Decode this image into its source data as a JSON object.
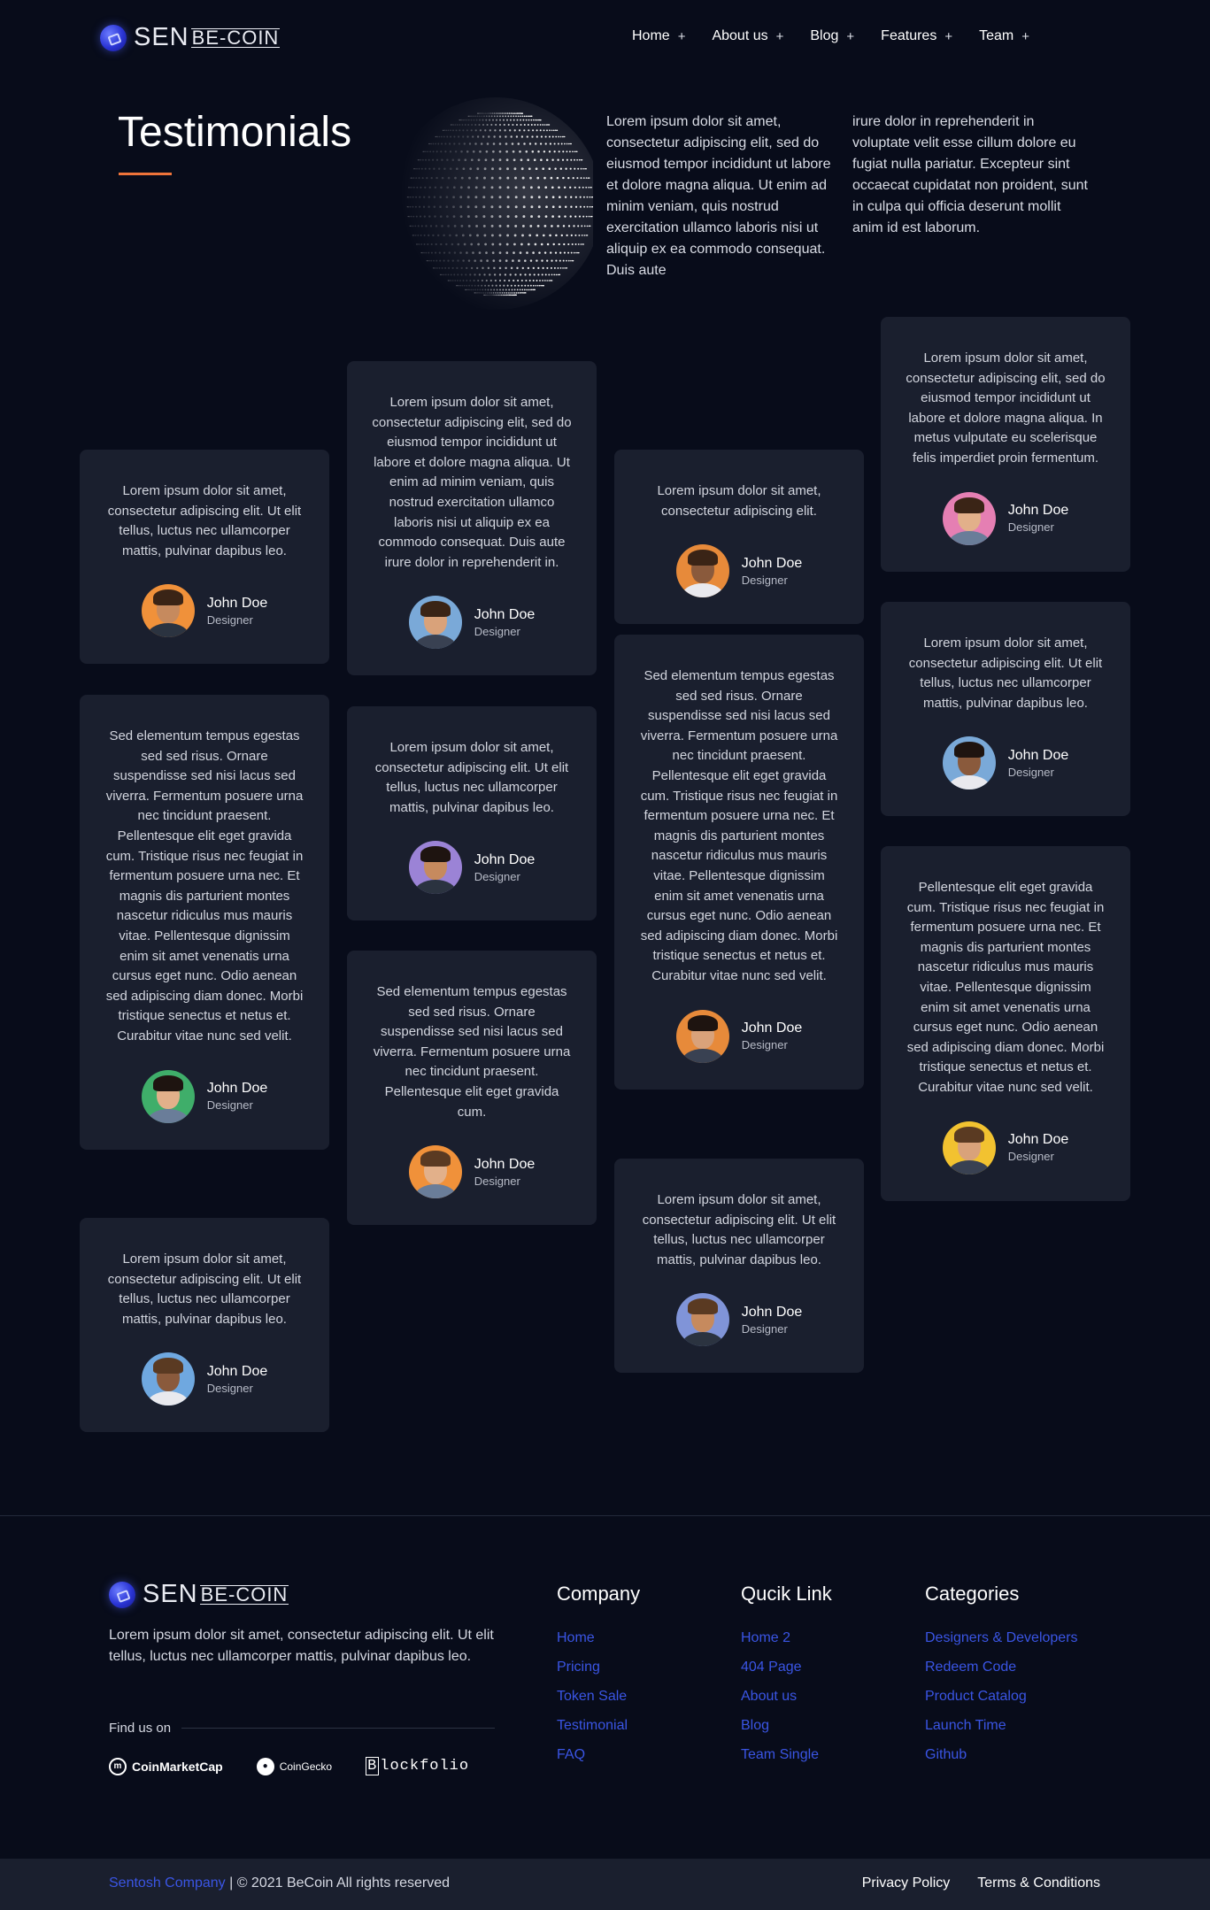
{
  "brand": {
    "sen": "SEN",
    "becoin": "BE-COIN"
  },
  "nav": [
    {
      "label": "Home",
      "suffix": "+"
    },
    {
      "label": "About us",
      "suffix": "+"
    },
    {
      "label": "Blog",
      "suffix": "+"
    },
    {
      "label": "Features",
      "suffix": "+"
    },
    {
      "label": "Team",
      "suffix": "+"
    }
  ],
  "hero": {
    "title": "Testimonials",
    "text_col1": "Lorem ipsum dolor sit amet, consectetur adipiscing elit, sed do eiusmod tempor incididunt ut labore et dolore magna aliqua. Ut enim ad minim veniam, quis nostrud exercitation ullamco laboris nisi ut aliquip ex ea commodo consequat. Duis aute",
    "text_col2": "irure dolor in reprehenderit in voluptate velit esse cillum dolore eu fugiat nulla pariatur. Excepteur sint occaecat cupidatat non proident, sunt in culpa qui officia deserunt mollit anim id est laborum."
  },
  "testimonials": [
    {
      "text": "Lorem ipsum dolor sit amet, consectetur adipiscing elit. Ut elit tellus, luctus nec ullamcorper mattis, pulvinar dapibus leo.",
      "name": "John Doe",
      "role": "Designer",
      "avatar_bg": "#f0913a"
    },
    {
      "text": "Sed elementum tempus egestas sed sed risus. Ornare suspendisse sed nisi lacus sed viverra. Fermentum posuere urna nec tincidunt praesent. Pellentesque elit eget gravida cum. Tristique risus nec feugiat in fermentum posuere urna nec. Et magnis dis parturient montes nascetur ridiculus mus mauris vitae. Pellentesque dignissim enim sit amet venenatis urna cursus eget nunc. Odio aenean sed adipiscing diam donec. Morbi tristique senectus et netus et. Curabitur vitae nunc sed velit.",
      "name": "John Doe",
      "role": "Designer",
      "avatar_bg": "#3fae6a"
    },
    {
      "text": "Lorem ipsum dolor sit amet, consectetur adipiscing elit. Ut elit tellus, luctus nec ullamcorper mattis, pulvinar dapibus leo.",
      "name": "John Doe",
      "role": "Designer",
      "avatar_bg": "#6fa8e0"
    },
    {
      "text": "Lorem ipsum dolor sit amet, consectetur adipiscing elit, sed do eiusmod tempor incididunt ut labore et dolore magna aliqua. Ut enim ad minim veniam, quis nostrud exercitation ullamco laboris nisi ut aliquip ex ea commodo consequat. Duis aute irure dolor in reprehenderit in.",
      "name": "John Doe",
      "role": "Designer",
      "avatar_bg": "#7aa9d8"
    },
    {
      "text": "Lorem ipsum dolor sit amet, consectetur adipiscing elit. Ut elit tellus, luctus nec ullamcorper mattis, pulvinar dapibus leo.",
      "name": "John Doe",
      "role": "Designer",
      "avatar_bg": "#9b83d6"
    },
    {
      "text": "Sed elementum tempus egestas sed sed risus. Ornare suspendisse sed nisi lacus sed viverra. Fermentum posuere urna nec tincidunt praesent. Pellentesque elit eget gravida cum.",
      "name": "John Doe",
      "role": "Designer",
      "avatar_bg": "#f0913a"
    },
    {
      "text": "Lorem ipsum dolor sit amet, consectetur adipiscing elit.",
      "name": "John Doe",
      "role": "Designer",
      "avatar_bg": "#e78a3a"
    },
    {
      "text": "Sed elementum tempus egestas sed sed risus. Ornare suspendisse sed nisi lacus sed viverra. Fermentum posuere urna nec tincidunt praesent. Pellentesque elit eget gravida cum. Tristique risus nec feugiat in fermentum posuere urna nec. Et magnis dis parturient montes nascetur ridiculus mus mauris vitae. Pellentesque dignissim enim sit amet venenatis urna cursus eget nunc. Odio aenean sed adipiscing diam donec. Morbi tristique senectus et netus et. Curabitur vitae nunc sed velit.",
      "name": "John Doe",
      "role": "Designer",
      "avatar_bg": "#e78a3a"
    },
    {
      "text": "Lorem ipsum dolor sit amet, consectetur adipiscing elit. Ut elit tellus, luctus nec ullamcorper mattis, pulvinar dapibus leo.",
      "name": "John Doe",
      "role": "Designer",
      "avatar_bg": "#8094d8"
    },
    {
      "text": "Lorem ipsum dolor sit amet, consectetur adipiscing elit, sed do eiusmod tempor incididunt ut labore et dolore magna aliqua. In metus vulputate eu scelerisque felis imperdiet proin fermentum.",
      "name": "John Doe",
      "role": "Designer",
      "avatar_bg": "#e57fb3"
    },
    {
      "text": "Lorem ipsum dolor sit amet, consectetur adipiscing elit. Ut elit tellus, luctus nec ullamcorper mattis, pulvinar dapibus leo.",
      "name": "John Doe",
      "role": "Designer",
      "avatar_bg": "#7aa9d8"
    },
    {
      "text": "Pellentesque elit eget gravida cum. Tristique risus nec feugiat in fermentum posuere urna nec. Et magnis dis parturient montes nascetur ridiculus mus mauris vitae. Pellentesque dignissim enim sit amet venenatis urna cursus eget nunc. Odio aenean sed adipiscing diam donec. Morbi tristique senectus et netus et. Curabitur vitae nunc sed velit.",
      "name": "John Doe",
      "role": "Designer",
      "avatar_bg": "#f2c230"
    }
  ],
  "footer": {
    "description": "Lorem ipsum dolor sit amet, consectetur adipiscing elit. Ut elit tellus, luctus nec ullamcorper mattis, pulvinar dapibus leo.",
    "find_us": "Find us on",
    "partners": {
      "cmc": "CoinMarketCap",
      "gecko": "CoinGecko",
      "blockfolio_b": "B",
      "blockfolio_rest": "lockfolio"
    },
    "columns": [
      {
        "title": "Company",
        "links": [
          "Home",
          "Pricing",
          "Token Sale",
          "Testimonial",
          "FAQ"
        ]
      },
      {
        "title": "Qucik Link",
        "links": [
          "Home 2",
          "404 Page",
          "About us",
          "Blog",
          "Team Single"
        ]
      },
      {
        "title": "Categories",
        "links": [
          "Designers & Developers",
          "Redeem Code",
          "Product Catalog",
          "Launch Time",
          "Github"
        ]
      }
    ],
    "company_name": "Sentosh Company",
    "copyright": " | © 2021 BeCoin All rights reserved",
    "bottom_links": [
      "Privacy Policy",
      "Terms & Conditions"
    ]
  },
  "colors": {
    "background": "#080c1a",
    "card": "#1a1f2e",
    "accent": "#f0743a",
    "link": "#3a55e4"
  }
}
